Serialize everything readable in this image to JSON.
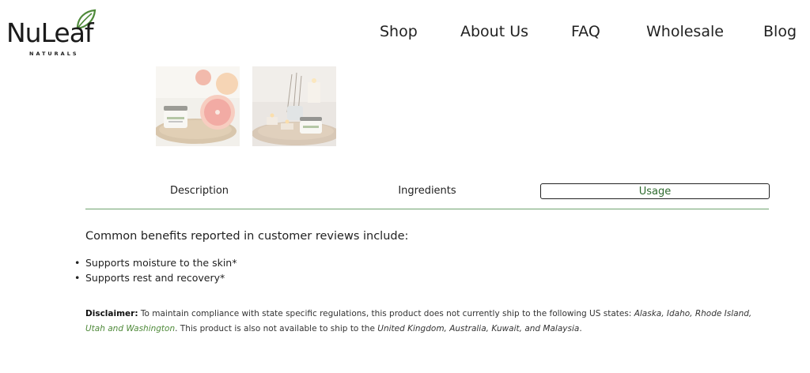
{
  "header": {
    "logo_text": "NuLeaf",
    "logo_sub": "NATURALS",
    "nav": [
      "Shop",
      "About Us",
      "FAQ",
      "Wholesale",
      "Blog"
    ]
  },
  "gallery": {
    "images": [
      "balm jar with grapefruit",
      "balm jar with candles and reed diffuser"
    ]
  },
  "tabs": {
    "items": [
      "Description",
      "Ingredients",
      "Usage"
    ],
    "active": "Usage"
  },
  "content": {
    "intro": "Common benefits reported in customer reviews include:",
    "bullets": [
      "Supports moisture to the skin*",
      "Supports rest and recovery*"
    ],
    "disclaimer": {
      "label": "Disclaimer:",
      "text_1": " To maintain compliance with state specific regulations, this product does not currently ship to the following US states: ",
      "states_black": "Alaska, Idaho, Rhode Island,",
      "states_green": " Utah and Washington",
      "text_2": ". This product is also not available to ship to the ",
      "countries": "United Kingdom, Australia, Kuwait, and Malaysia",
      "text_3": "."
    }
  },
  "colors": {
    "accent_green": "#4f8a3a",
    "tab_line": "#6fa36f",
    "text": "#222222"
  }
}
